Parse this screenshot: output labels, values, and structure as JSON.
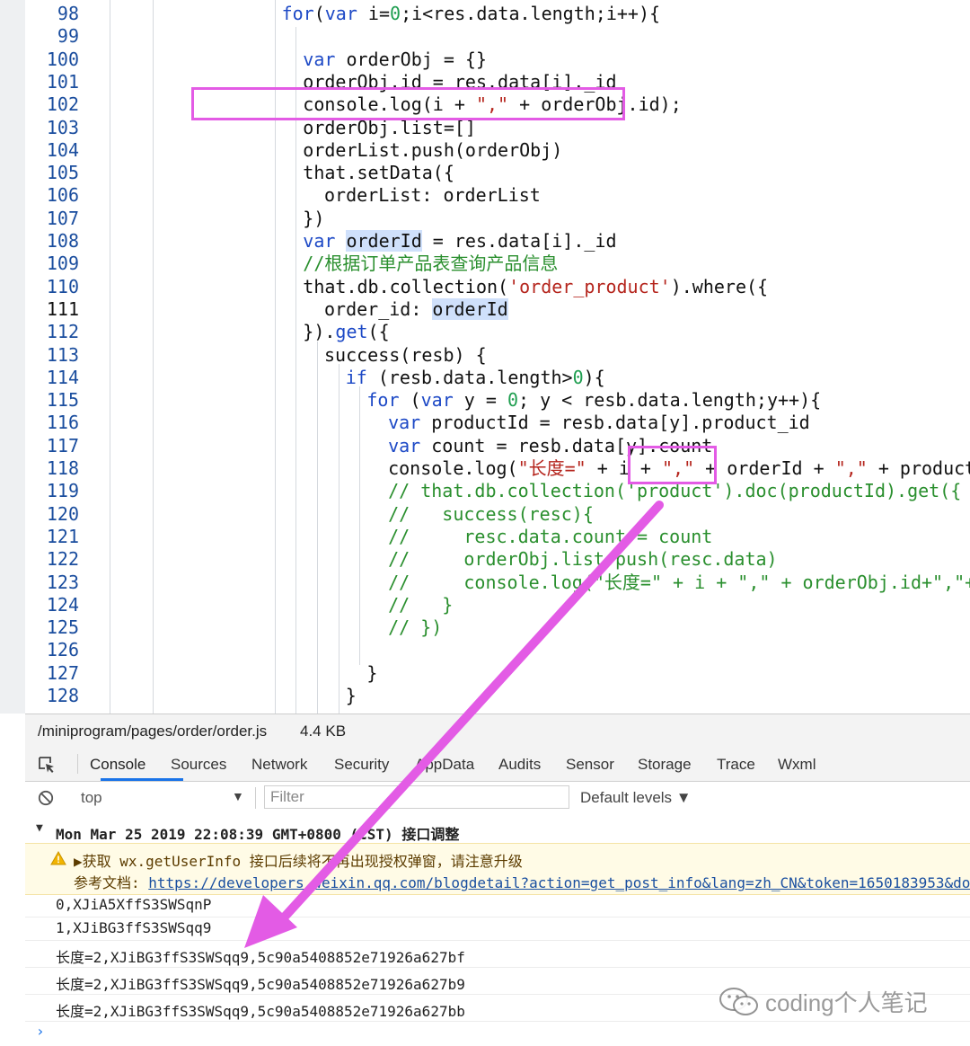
{
  "editor": {
    "lines": [
      {
        "n": "98",
        "indent": 8,
        "tokens": [
          [
            "k",
            "for"
          ],
          [
            "",
            "("
          ],
          [
            "k",
            "var"
          ],
          [
            "",
            " i="
          ],
          [
            "n",
            "0"
          ],
          [
            "",
            ";i<res.data.length;i++){"
          ]
        ]
      },
      {
        "n": "99",
        "indent": 0,
        "tokens": []
      },
      {
        "n": "100",
        "indent": 9,
        "tokens": [
          [
            "k",
            "var"
          ],
          [
            "",
            " orderObj = {}"
          ]
        ]
      },
      {
        "n": "101",
        "indent": 9,
        "tokens": [
          [
            "",
            "orderObj.id = res.data[i]._id"
          ]
        ]
      },
      {
        "n": "102",
        "indent": 9,
        "tokens": [
          [
            "",
            "console.log(i + "
          ],
          [
            "s",
            "\",\""
          ],
          [
            "",
            " + orderObj.id);"
          ]
        ]
      },
      {
        "n": "103",
        "indent": 9,
        "tokens": [
          [
            "",
            "orderObj.list=[]"
          ]
        ]
      },
      {
        "n": "104",
        "indent": 9,
        "tokens": [
          [
            "",
            "orderList.push(orderObj)"
          ]
        ]
      },
      {
        "n": "105",
        "indent": 9,
        "tokens": [
          [
            "",
            "that.setData({"
          ]
        ]
      },
      {
        "n": "106",
        "indent": 10,
        "tokens": [
          [
            "",
            "orderList: orderList"
          ]
        ]
      },
      {
        "n": "107",
        "indent": 9,
        "tokens": [
          [
            "",
            "})"
          ]
        ]
      },
      {
        "n": "108",
        "indent": 9,
        "tokens": [
          [
            "k",
            "var"
          ],
          [
            "",
            " "
          ],
          [
            "hl",
            "orderId"
          ],
          [
            "",
            " = res.data[i]._id"
          ]
        ]
      },
      {
        "n": "109",
        "indent": 9,
        "tokens": [
          [
            "c",
            "//根据订单产品表查询产品信息"
          ]
        ]
      },
      {
        "n": "110",
        "indent": 9,
        "tokens": [
          [
            "",
            "that.db.collection("
          ],
          [
            "s",
            "'order_product'"
          ],
          [
            "",
            ").where({"
          ]
        ]
      },
      {
        "n": "111",
        "indent": 10,
        "tokens": [
          [
            "",
            "order_id: "
          ],
          [
            "hl",
            "orderId"
          ]
        ]
      },
      {
        "n": "112",
        "indent": 9,
        "tokens": [
          [
            "",
            "})."
          ],
          [
            "k",
            "get"
          ],
          [
            "",
            "({"
          ]
        ]
      },
      {
        "n": "113",
        "indent": 10,
        "tokens": [
          [
            "",
            "success(resb) {"
          ]
        ]
      },
      {
        "n": "114",
        "indent": 11,
        "tokens": [
          [
            "k",
            "if"
          ],
          [
            "",
            " (resb.data.length>"
          ],
          [
            "n",
            "0"
          ],
          [
            "",
            "){"
          ]
        ]
      },
      {
        "n": "115",
        "indent": 12,
        "tokens": [
          [
            "k",
            "for"
          ],
          [
            "",
            " ("
          ],
          [
            "k",
            "var"
          ],
          [
            "",
            " y = "
          ],
          [
            "n",
            "0"
          ],
          [
            "",
            "; y < resb.data.length;y++){"
          ]
        ]
      },
      {
        "n": "116",
        "indent": 13,
        "tokens": [
          [
            "k",
            "var"
          ],
          [
            "",
            " productId = resb.data[y].product_id"
          ]
        ]
      },
      {
        "n": "117",
        "indent": 13,
        "tokens": [
          [
            "k",
            "var"
          ],
          [
            "",
            " count = resb.data[y].count"
          ]
        ]
      },
      {
        "n": "118",
        "indent": 13,
        "tokens": [
          [
            "",
            "console.log("
          ],
          [
            "s",
            "\"长度=\""
          ],
          [
            "",
            " + i + "
          ],
          [
            "s",
            "\",\""
          ],
          [
            "",
            " + orderId + "
          ],
          [
            "s",
            "\",\""
          ],
          [
            "",
            " + productId)"
          ]
        ]
      },
      {
        "n": "119",
        "indent": 13,
        "tokens": [
          [
            "c",
            "// that.db.collection('product').doc(productId).get({"
          ]
        ]
      },
      {
        "n": "120",
        "indent": 13,
        "tokens": [
          [
            "c",
            "//   success(resc){"
          ]
        ]
      },
      {
        "n": "121",
        "indent": 13,
        "tokens": [
          [
            "c",
            "//     resc.data.count = count"
          ]
        ]
      },
      {
        "n": "122",
        "indent": 13,
        "tokens": [
          [
            "c",
            "//     orderObj.list.push(resc.data)"
          ]
        ]
      },
      {
        "n": "123",
        "indent": 13,
        "tokens": [
          [
            "c",
            "//     console.log(\"长度=\" + i + \",\" + orderObj.id+\",\"+ orderObj"
          ]
        ]
      },
      {
        "n": "124",
        "indent": 13,
        "tokens": [
          [
            "c",
            "//   }"
          ]
        ]
      },
      {
        "n": "125",
        "indent": 13,
        "tokens": [
          [
            "c",
            "// })"
          ]
        ]
      },
      {
        "n": "126",
        "indent": 0,
        "tokens": []
      },
      {
        "n": "127",
        "indent": 12,
        "tokens": [
          [
            "",
            "}"
          ]
        ]
      },
      {
        "n": "128",
        "indent": 11,
        "tokens": [
          [
            "",
            "}"
          ]
        ]
      }
    ],
    "current_line": "111"
  },
  "filebar": {
    "path": "/miniprogram/pages/order/order.js",
    "size": "4.4 KB"
  },
  "tabs": [
    "Console",
    "Sources",
    "Network",
    "Security",
    "AppData",
    "Audits",
    "Sensor",
    "Storage",
    "Trace",
    "Wxml"
  ],
  "active_tab": "Console",
  "toolbar": {
    "context": "top",
    "filter_placeholder": "Filter",
    "levels": "Default levels ▼"
  },
  "console": {
    "group_header": "Mon Mar 25 2019 22:08:39 GMT+0800 (CST) 接口调整",
    "warning_text": "▶获取 wx.getUserInfo 接口后续将不再出现授权弹窗，请注意升级",
    "warning_doc_label": "参考文档: ",
    "warning_doc_link": "https://developers.weixin.qq.com/blogdetail?action=get_post_info&lang=zh_CN&token=1650183953&docid=",
    "logs": [
      "0,XJiA5XffS3SWSqnP",
      "1,XJiBG3ffS3SWSqq9",
      "长度=2,XJiBG3ffS3SWSqq9,5c90a5408852e71926a627bf",
      "长度=2,XJiBG3ffS3SWSqq9,5c90a5408852e71926a627b9",
      "长度=2,XJiBG3ffS3SWSqq9,5c90a5408852e71926a627bb"
    ],
    "prompt": "›"
  },
  "watermark": {
    "text": "coding个人笔记"
  },
  "colors": {
    "annotation": "#e35be5",
    "keyword": "#1d49c6",
    "string": "#b5251d",
    "comment": "#2a8f2e",
    "highlight": "#cfe0fb"
  }
}
